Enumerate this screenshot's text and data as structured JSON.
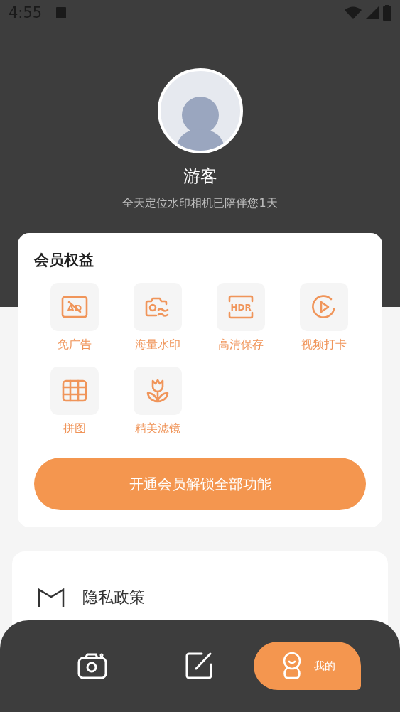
{
  "status_bar": {
    "time": "4:55"
  },
  "profile": {
    "name": "游客",
    "subtitle": "全天定位水印相机已陪伴您1天"
  },
  "benefits": {
    "title": "会员权益",
    "items": [
      {
        "kind": "ad",
        "badge": "AD",
        "label": "免广告"
      },
      {
        "kind": "watermark",
        "label": "海量水印"
      },
      {
        "kind": "hdr",
        "badge": "HDR",
        "label": "高清保存"
      },
      {
        "kind": "video",
        "label": "视频打卡"
      },
      {
        "kind": "grid",
        "label": "拼图"
      },
      {
        "kind": "filter",
        "label": "精美滤镜"
      }
    ],
    "button": "开通会员解锁全部功能"
  },
  "menu": [
    {
      "kind": "shield",
      "label": "隐私政策"
    }
  ],
  "nav": [
    {
      "kind": "camera",
      "selected": false
    },
    {
      "kind": "edit",
      "selected": false
    },
    {
      "kind": "profile",
      "label": "我的",
      "selected": true
    }
  ]
}
